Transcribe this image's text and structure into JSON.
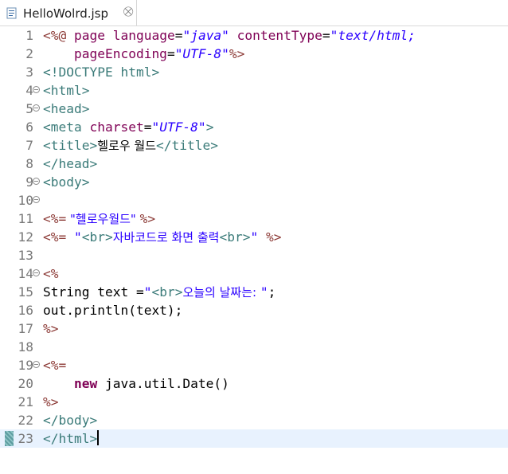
{
  "tab": {
    "title": "HelloWolrd.jsp",
    "close_glyph": "⛒"
  },
  "lines": [
    {
      "n": "1",
      "fold": false
    },
    {
      "n": "2",
      "fold": false
    },
    {
      "n": "3",
      "fold": false
    },
    {
      "n": "4",
      "fold": true
    },
    {
      "n": "5",
      "fold": true
    },
    {
      "n": "6",
      "fold": false
    },
    {
      "n": "7",
      "fold": false
    },
    {
      "n": "8",
      "fold": false
    },
    {
      "n": "9",
      "fold": true
    },
    {
      "n": "10",
      "fold": true
    },
    {
      "n": "11",
      "fold": false
    },
    {
      "n": "12",
      "fold": false
    },
    {
      "n": "13",
      "fold": false
    },
    {
      "n": "14",
      "fold": true
    },
    {
      "n": "15",
      "fold": false
    },
    {
      "n": "16",
      "fold": false
    },
    {
      "n": "17",
      "fold": false
    },
    {
      "n": "18",
      "fold": false
    },
    {
      "n": "19",
      "fold": true
    },
    {
      "n": "20",
      "fold": false
    },
    {
      "n": "21",
      "fold": false
    },
    {
      "n": "22",
      "fold": false
    },
    {
      "n": "23",
      "fold": false
    }
  ],
  "code": {
    "l1": {
      "open": "<%@",
      "page": " page ",
      "lang_attr": "language",
      "eq1": "=",
      "lang_val": "\"java\"",
      "ct_attr": " contentType",
      "eq2": "=",
      "ct_val": "\"text/html;"
    },
    "l2": {
      "indent": "    ",
      "pe_attr": "pageEncoding",
      "eq": "=",
      "pe_val": "\"UTF-8\"",
      "close": "%>"
    },
    "l3": {
      "text": "<!DOCTYPE html>"
    },
    "l4": {
      "text": "<html>"
    },
    "l5": {
      "text": "<head>"
    },
    "l6": {
      "tag": "<meta",
      "attr": " charset",
      "eq": "=",
      "val": "\"UTF-8\"",
      "end": ">"
    },
    "l7": {
      "open": "<title>",
      "content": "헬로우 월드",
      "close": "</title>"
    },
    "l8": {
      "text": "</head>"
    },
    "l9": {
      "text": "<body>"
    },
    "l11": {
      "open": "<%=",
      "str": " \"헬로우월드\" ",
      "close": "%>"
    },
    "l12": {
      "open": "<%=",
      "q1": " \"",
      "br1": "<br>",
      "mid": "자바코드로 화면 출력",
      "br2": "<br>",
      "q2": "\" ",
      "close": "%>"
    },
    "l14": {
      "open": "<%"
    },
    "l15": {
      "pre": "String text =",
      "q1": "\"",
      "br": "<br>",
      "kr": "오늘의 날짜는: ",
      "q2": "\"",
      "semi": ";"
    },
    "l16": {
      "text": "out.println(text);"
    },
    "l17": {
      "close": "%>"
    },
    "l19": {
      "open": "<%="
    },
    "l20": {
      "indent": "    ",
      "kw": "new",
      "rest": " java.util.Date()"
    },
    "l21": {
      "close": "%>"
    },
    "l22": {
      "text": "</body>"
    },
    "l23": {
      "text": "</html>"
    }
  },
  "colors": {
    "jsp_delimiter": "#8c3a36",
    "html_tag": "#3b7b79",
    "attribute": "#7f0055",
    "value": "#2a00ff",
    "current_line": "#e8f2fe"
  },
  "icons": {
    "tab": "jsp-file-icon",
    "close": "close-tab-icon"
  }
}
